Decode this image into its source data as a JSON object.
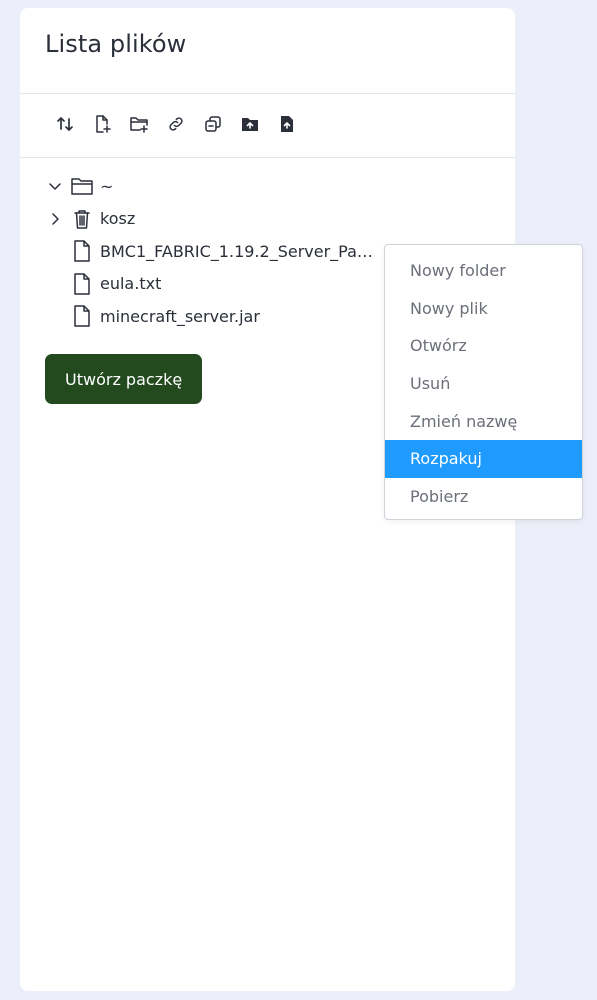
{
  "panel": {
    "title": "Lista plików"
  },
  "toolbar": {
    "buttons": [
      {
        "icon": "sort-icon"
      },
      {
        "icon": "new-file-icon"
      },
      {
        "icon": "new-folder-icon"
      },
      {
        "icon": "link-icon"
      },
      {
        "icon": "copy-icon"
      },
      {
        "icon": "upload-folder-icon"
      },
      {
        "icon": "upload-file-icon"
      }
    ]
  },
  "tree": {
    "root": {
      "label": "~",
      "expanded": true
    },
    "items": [
      {
        "label": "kosz",
        "type": "trash",
        "expandable": true
      },
      {
        "label": "BMC1_FABRIC_1.19.2_Server_Pack...",
        "type": "file"
      },
      {
        "label": "eula.txt",
        "type": "file"
      },
      {
        "label": "minecraft_server.jar",
        "type": "file"
      }
    ]
  },
  "actions": {
    "create_package": "Utwórz paczkę"
  },
  "context_menu": {
    "items": [
      {
        "label": "Nowy folder"
      },
      {
        "label": "Nowy plik"
      },
      {
        "label": "Otwórz"
      },
      {
        "label": "Usuń"
      },
      {
        "label": "Zmień nazwę"
      },
      {
        "label": "Rozpakuj",
        "active": true
      },
      {
        "label": "Pobierz"
      }
    ]
  },
  "colors": {
    "background": "#eceef9",
    "panel": "#ffffff",
    "primary_button": "#234a1f",
    "menu_active": "#1f9bff",
    "text": "#2b2f3a",
    "menu_text": "#6b6f78"
  }
}
